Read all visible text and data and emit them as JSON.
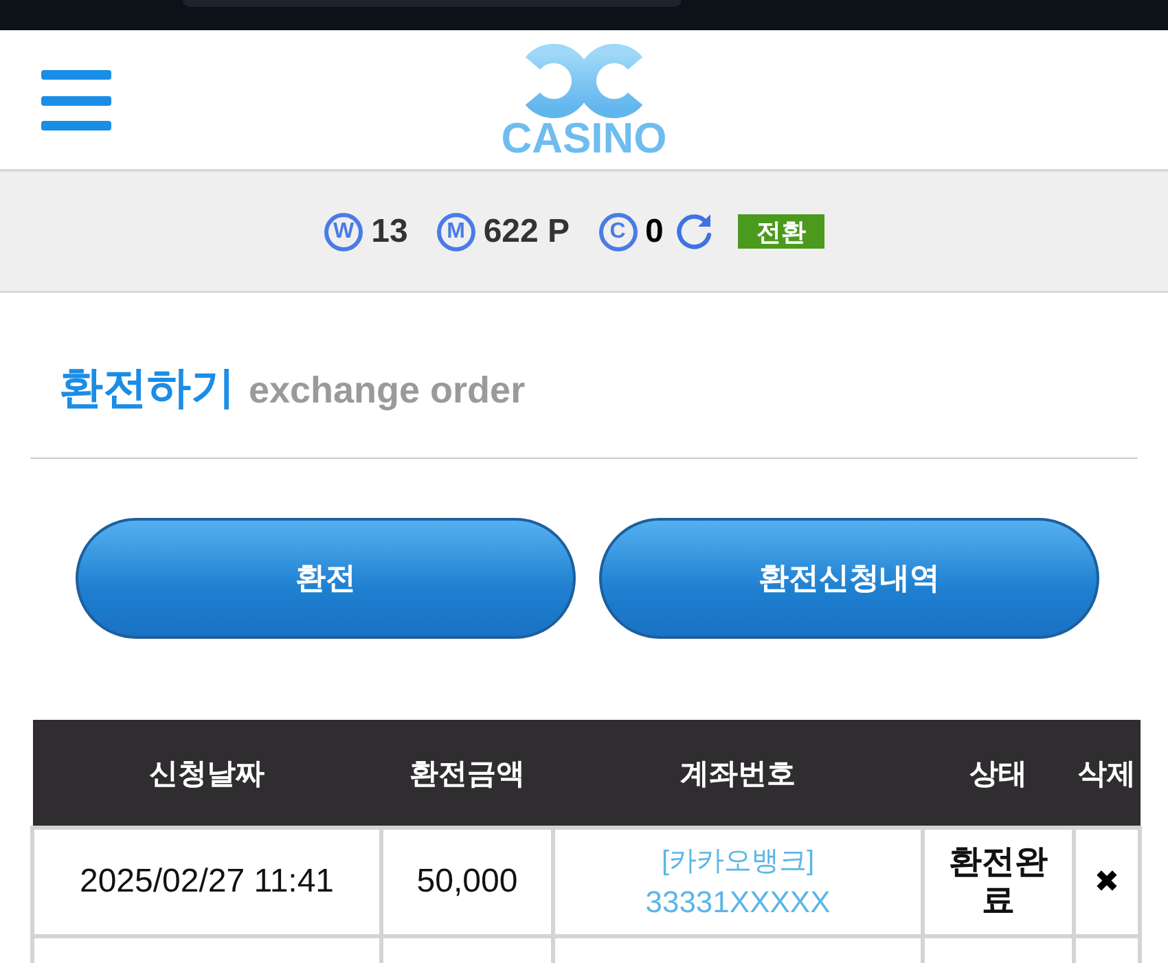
{
  "header": {
    "logo_text": "CASINO"
  },
  "balances": [
    {
      "symbol": "W",
      "value": "13"
    },
    {
      "symbol": "M",
      "value": "622 P"
    },
    {
      "symbol": "C",
      "value": "0"
    }
  ],
  "convert_button": "전환",
  "page_title": {
    "title": "환전하기",
    "subtitle": "exchange order"
  },
  "buttons": [
    "환전",
    "환전신청내역"
  ],
  "table": {
    "columns": [
      "신청날짜",
      "환전금액",
      "계좌번호",
      "상태",
      "삭제"
    ],
    "rows": [
      {
        "date": "2025/02/27 11:41",
        "amount": "50,000",
        "bank": "[카카오뱅크]",
        "account": "33331XXXXX",
        "status": "환전완료",
        "delete": "✖"
      }
    ]
  }
}
